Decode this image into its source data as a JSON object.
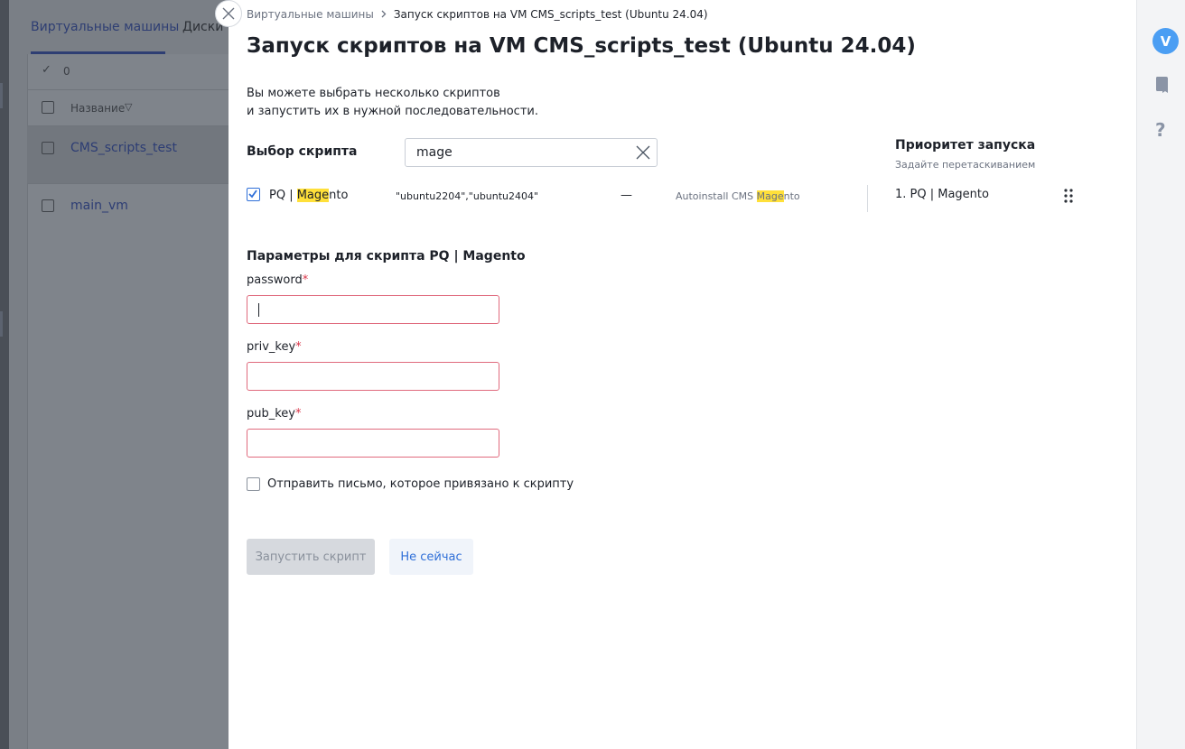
{
  "background": {
    "tabs": [
      "Виртуальные машины",
      "Диски V"
    ],
    "selected_count": "0",
    "column_name": "Название",
    "rows": [
      "CMS_scripts_test",
      "main_vm"
    ]
  },
  "sidebar": {
    "avatar_letter": "V"
  },
  "modal": {
    "breadcrumb": [
      "Виртуальные машины",
      "Запуск скриптов на VM CMS_scripts_test (Ubuntu 24.04)"
    ],
    "title": "Запуск скриптов на VM CMS_scripts_test (Ubuntu 24.04)",
    "description_line1": "Вы можете выбрать несколько скриптов",
    "description_line2": "и запустить их в нужной последовательности.",
    "script_select_label": "Выбор скрипта",
    "search_value": "mage",
    "script_row": {
      "name_prefix": "PQ | ",
      "name_highlight": "Mage",
      "name_suffix": "nto",
      "os": "\"ubuntu2204\",\"ubuntu2404\"",
      "dash": "—",
      "desc_prefix": "Autoinstall CMS ",
      "desc_highlight": "Mage",
      "desc_suffix": "nto",
      "checked": true
    },
    "priority": {
      "title": "Приоритет запуска",
      "subtitle": "Задайте перетаскиванием",
      "item": "1.  PQ | Magento"
    },
    "params_title": "Параметры для скрипта PQ | Magento",
    "fields": [
      {
        "label": "password",
        "required_mark": "*",
        "value": ""
      },
      {
        "label": "priv_key",
        "required_mark": "*",
        "value": ""
      },
      {
        "label": "pub_key",
        "required_mark": "*",
        "value": ""
      }
    ],
    "email_checkbox_label": "Отправить письмо, которое привязано к скрипту",
    "run_button": "Запустить скрипт",
    "later_button": "Не сейчас"
  },
  "colors": {
    "accent": "#2f6fd8",
    "highlight": "#ffe03a",
    "required": "#d9364a",
    "avatar": "#4b9ef3"
  }
}
